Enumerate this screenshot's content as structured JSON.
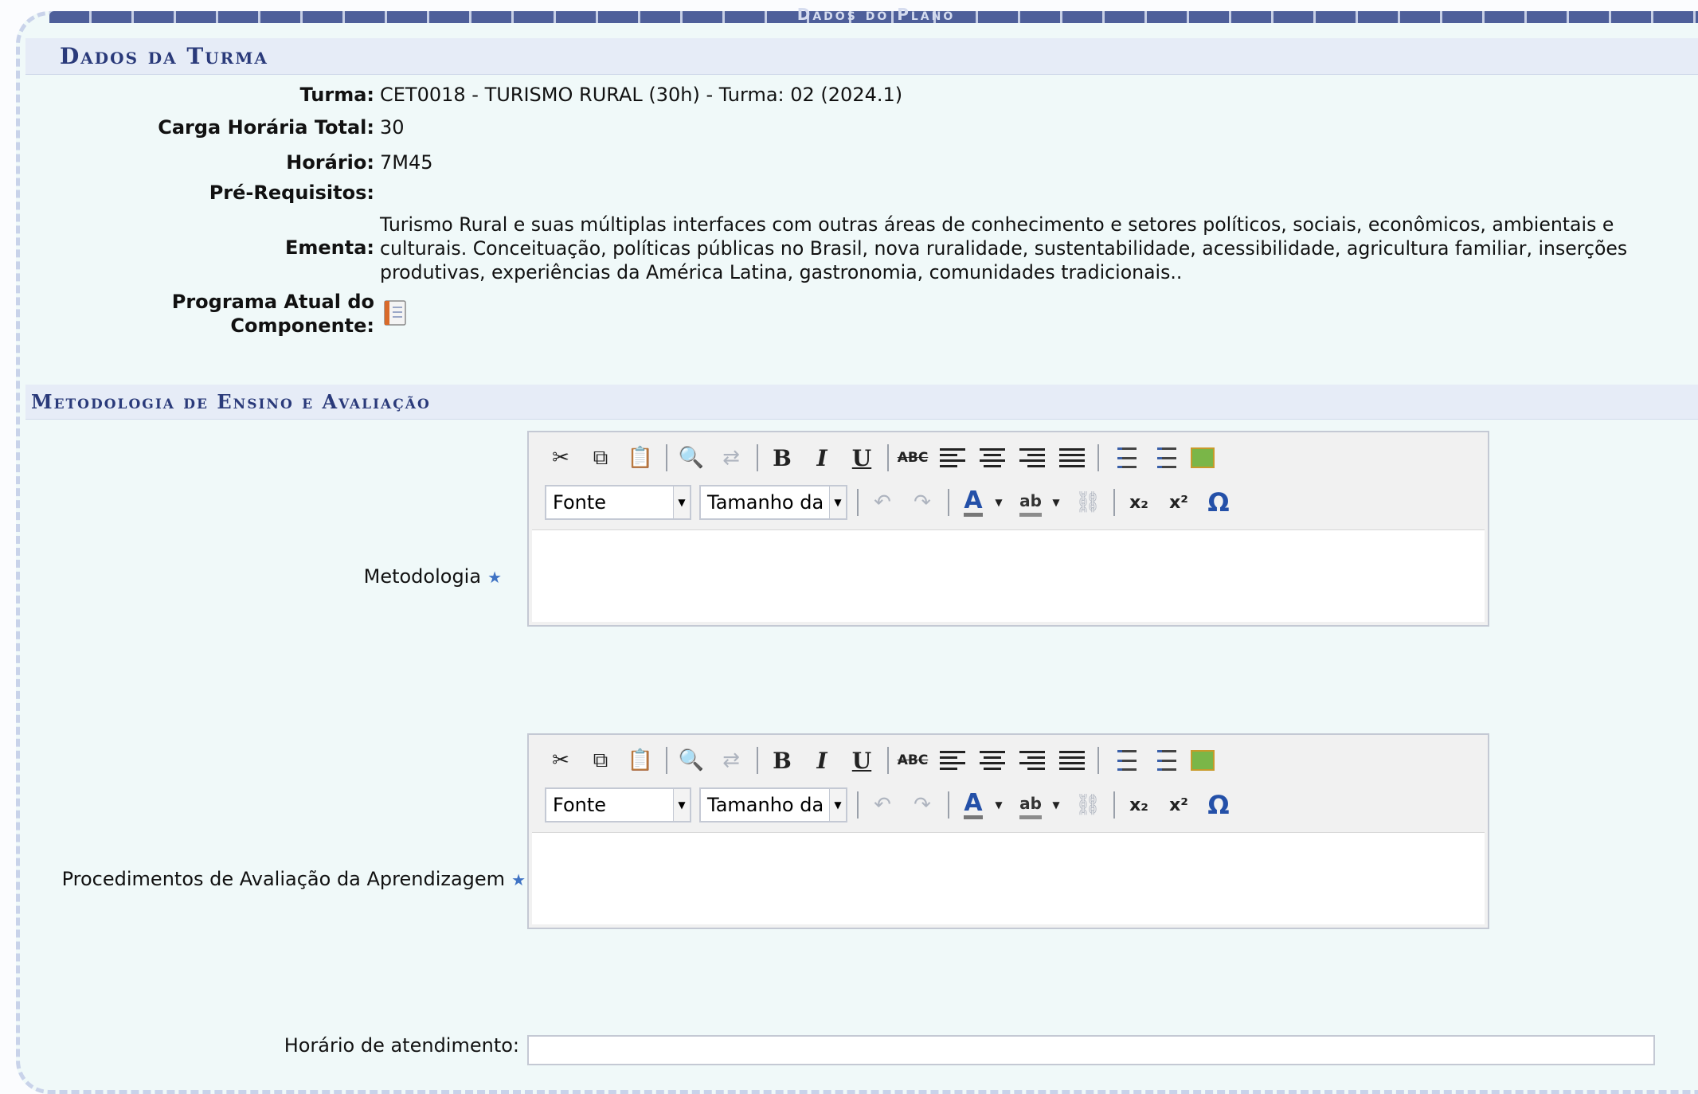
{
  "top_title": "Dados do Plano",
  "section_turma": {
    "title": "Dados da Turma",
    "fields": [
      {
        "label": "Turma:",
        "value": "CET0018 - TURISMO RURAL (30h) - Turma: 02 (2024.1)"
      },
      {
        "label": "Carga Horária Total:",
        "value": "30"
      },
      {
        "label": "Horário:",
        "value": "7M45"
      },
      {
        "label": "Pré-Requisitos:",
        "value": ""
      },
      {
        "label": "Ementa:",
        "value": ""
      }
    ],
    "ementa_lines": [
      "Turismo Rural e suas múltiplas interfaces com outras áreas de conhecimento e setores políticos, sociais, econômicos, ambientais e",
      "culturais. Conceituação, políticas públicas no Brasil, nova ruralidade, sustentabilidade, acessibilidade, agricultura familiar, inserções",
      "produtivas, experiências da América Latina, gastronomia, comunidades tradicionais.."
    ],
    "programa_label_line1": "Programa Atual do",
    "programa_label_line2": "Componente:",
    "programa_icon": "document-icon"
  },
  "section_metodologia": {
    "title": "Metodologia de Ensino e Avaliação",
    "metodologia_label": "Metodologia",
    "procedimentos_label": "Procedimentos de Avaliação da Aprendizagem",
    "horario_label": "Horário de atendimento:",
    "required_mark": "★"
  },
  "editor": {
    "font_select": "Fonte",
    "size_select": "Tamanho da Fo",
    "bold": "B",
    "italic": "I",
    "underline": "U",
    "strike": "ABC",
    "font_color": "A",
    "highlight": "ab",
    "subscript": "x₂",
    "superscript": "x²",
    "special_char": "Ω"
  },
  "colors": {
    "section_title": "#2a3a7a",
    "section_bg": "#e6ecf7",
    "page_bg": "#f0f9f9",
    "stripe": "#4e5f9a",
    "required_star": "#3f73c4"
  }
}
